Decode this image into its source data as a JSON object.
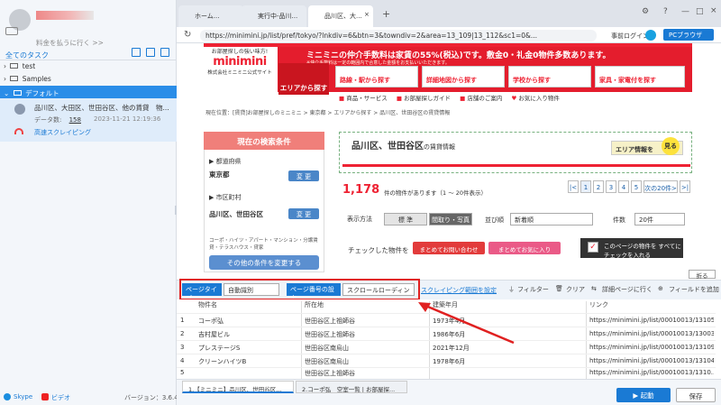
{
  "sidebar": {
    "upgrade_link": "料金を払うに行く >>",
    "task_header": "全てのタスク",
    "tree": [
      "test",
      "Samples",
      "デフォルト"
    ],
    "task": {
      "title": "品川区、大田区、世田谷区、他の賃貸　物...",
      "count_label": "データ数:",
      "count": "158",
      "date": "2023-11-21 12:19:36",
      "status": "高速スクレイピング"
    },
    "skype": "Skype",
    "video": "ビデオ",
    "version": "バージョン：3.6.4"
  },
  "browser": {
    "tabs": [
      "ホーム...",
      "実行中-品川...",
      "品川区、大..."
    ],
    "url": "https://minimini.jp/list/pref/tokyo/?lnkdiv=6&btn=3&towndiv=2&area=13_109|13_112&sc1=0&...",
    "login": "事前ログイン",
    "pc_browser": "PCブラウザ"
  },
  "site": {
    "logo_top": "お部屋探しの強い味方!",
    "logo_main": "minimini",
    "logo_sub": "株式会社ミニミニ公式サイト",
    "banner_text": "ミニミニの仲介手数料は家賃の55%(税込)です。敷金0・礼金0物件多数あります。",
    "banner_sub": "※仲介手数料は一定の範囲内で合意した金額をお支払いいただきます。",
    "area_button": "エリアから探す",
    "nav": [
      "路線・駅から探す",
      "詳細地図から探す",
      "学校から探す",
      "家具・家電付を探す"
    ],
    "subnav": [
      "商品・サービス",
      "お部屋探しガイド",
      "店舗のご案内",
      "お気に入り物件"
    ],
    "breadcrumb": "現在位置：[賃貸]お部屋探しのミニミニ > 東京都 > エリアから探す > 品川区、世田谷区の賃貸情報"
  },
  "search": {
    "title": "現在の検索条件",
    "pref_label": "都道府県",
    "pref_value": "東京都",
    "city_label": "市区町村",
    "city_value": "品川区、世田谷区",
    "change": "変 更",
    "types": "コーポ・ハイツ・アパート・マンション・分譲賃貸・テラスハウス・貸家",
    "other_button": "その他の条件を変更する"
  },
  "results": {
    "title": "品川区、世田谷区",
    "title_suffix": "の賃貸情報",
    "area_info": "エリア情報を",
    "see": "見る",
    "count": "1,178",
    "count_text": "件の物件があります（1 〜 20件表示）",
    "pages": [
      "|<",
      "1",
      "2",
      "3",
      "4",
      "5",
      "次の20件>",
      ">|"
    ],
    "display_label": "表示方法",
    "display_standard": "標 準",
    "display_photo": "間取り・写真",
    "sort_label": "並び順",
    "sort_value": "新着順",
    "count_label": "件数",
    "count_value": "20件",
    "check_text": "チェックした物件を",
    "inquiry": "まとめてお問い合わせ",
    "favorite": "まとめてお気に入り",
    "all_check": "このページの物件を すべてにチェックを入れる",
    "collapse": "折る"
  },
  "toolbar": {
    "page_type_label": "ページタイプ",
    "page_type_value": "自動識別",
    "page_num_label": "ページ番号の設定",
    "page_num_value": "スクロールローディン",
    "scrape_range": "スクレイピング範囲を設定",
    "filter": "フィルター",
    "clear": "クリア",
    "detail": "詳細ページに行く",
    "add_field": "フィールドを追加"
  },
  "table": {
    "headers": [
      "物件名",
      "所在地",
      "建築年月",
      "リンク"
    ],
    "rows": [
      [
        "1",
        "コーポ弘",
        "世田谷区上祖師谷",
        "1973年4月",
        "https://minimini.jp/list/00010013/1310524..."
      ],
      [
        "2",
        "吉村屋ビル",
        "世田谷区上祖師谷",
        "1986年6月",
        "https://minimini.jp/list/00010013/1300361..."
      ],
      [
        "3",
        "プレステージS",
        "世田谷区南烏山",
        "2021年12月",
        "https://minimini.jp/list/00010013/1310986..."
      ],
      [
        "4",
        "クリーンハイツB",
        "世田谷区南烏山",
        "1978年6月",
        "https://minimini.jp/list/00010013/1310494..."
      ],
      [
        "5",
        "",
        "世田谷区上祖師谷",
        "",
        "https://minimini.jp/list/00010013/1310..."
      ]
    ]
  },
  "bottom": {
    "tabs": [
      "1.【ミニミニ】品川区、世田谷区...",
      "2.コーポ弘　空室一覧 | お部屋探..."
    ],
    "start": "▶ 起動",
    "save": "保存"
  }
}
